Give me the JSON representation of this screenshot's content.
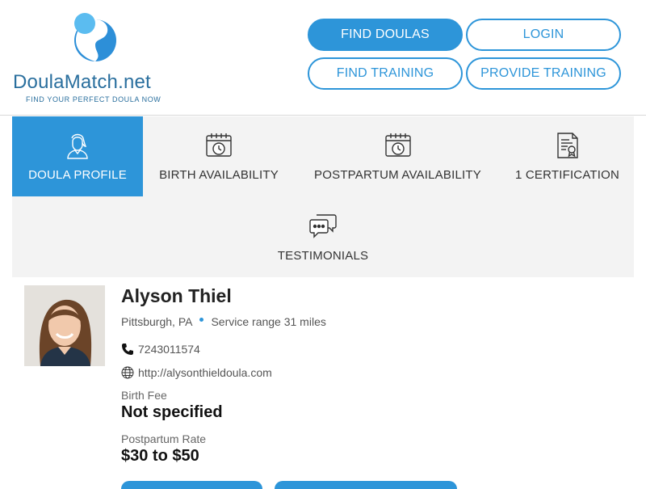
{
  "brand": {
    "name_part1": "Doula",
    "name_part2": "Match",
    "name_part3": ".net",
    "tagline": "FIND YOUR PERFECT DOULA NOW",
    "colors": {
      "primary": "#2d95d9",
      "logo_light": "#5bbcf0",
      "logo_dark": "#2d8fd8",
      "text": "#2a6f9e"
    }
  },
  "nav": {
    "find_doulas": "FIND DOULAS",
    "login": "LOGIN",
    "find_training": "FIND TRAINING",
    "provide_training": "PROVIDE TRAINING"
  },
  "tabs": [
    {
      "label": "DOULA PROFILE",
      "icon": "doula-icon",
      "active": true
    },
    {
      "label": "BIRTH AVAILABILITY",
      "icon": "calendar-clock-icon",
      "active": false
    },
    {
      "label": "POSTPARTUM AVAILABILITY",
      "icon": "calendar-clock-icon",
      "active": false
    },
    {
      "label": "1 CERTIFICATION",
      "icon": "certificate-icon",
      "active": false
    },
    {
      "label": "TESTIMONIALS",
      "icon": "chat-bubbles-icon",
      "active": false
    }
  ],
  "profile": {
    "name": "Alyson Thiel",
    "location": "Pittsburgh, PA",
    "service_range": "Service range 31 miles",
    "phone": "7243011574",
    "website": "http://alysonthieldoula.com",
    "birth_fee_label": "Birth Fee",
    "birth_fee_value": "Not specified",
    "postpartum_rate_label": "Postpartum Rate",
    "postpartum_rate_value": "$30 to $50"
  }
}
